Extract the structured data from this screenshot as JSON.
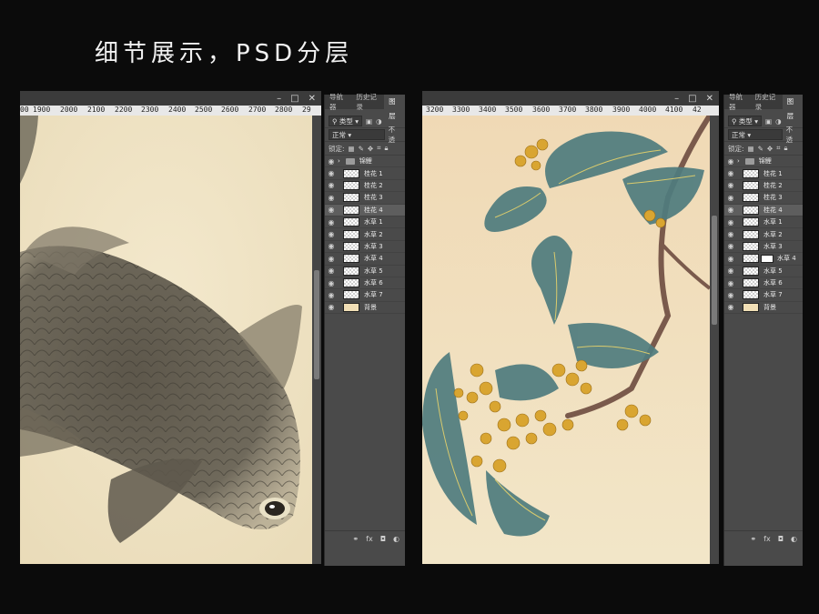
{
  "title": "细节展示，PSD分层",
  "window": {
    "minimize": "–",
    "restore": "□",
    "close": "✕"
  },
  "left": {
    "ruler": [
      "00",
      "1900",
      "2000",
      "2100",
      "2200",
      "2300",
      "2400",
      "2500",
      "2600",
      "2700",
      "2800",
      "29"
    ]
  },
  "right": {
    "ruler": [
      "3200",
      "3300",
      "3400",
      "3500",
      "3600",
      "3700",
      "3800",
      "3900",
      "4000",
      "4100",
      "42"
    ]
  },
  "panel": {
    "tabs": [
      "导航器",
      "历史记录",
      "图层"
    ],
    "active_tab": "图层",
    "filter": "类型",
    "blend": "正常",
    "opacity_label": "不透",
    "lock_label": "锁定:",
    "group": "锦鲤",
    "layers_left": [
      "桂花 1",
      "桂花 2",
      "桂花 3",
      "桂花 4",
      "水草 1",
      "水草 2",
      "水草 3",
      "水草 4",
      "水草 5",
      "水草 6",
      "水草 7",
      "背景"
    ],
    "layers_right": [
      "桂花 1",
      "桂花 2",
      "桂花 3",
      "桂花 4",
      "水草 1",
      "水草 2",
      "水草 3",
      "水草 4",
      "水草 5",
      "水草 6",
      "水草 7",
      "背景"
    ],
    "footer": [
      "⚭",
      "fx",
      "◘",
      "◐"
    ]
  },
  "colors": {
    "paper": "#efe3c4",
    "background": "#0b0b0b",
    "panel": "#4a4a4a"
  }
}
